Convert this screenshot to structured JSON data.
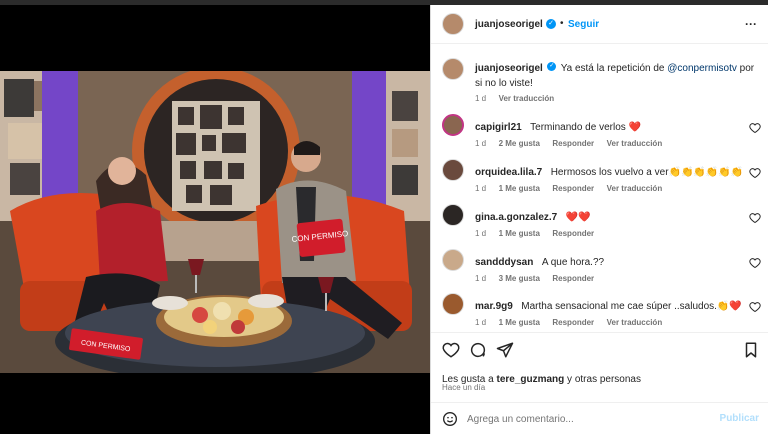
{
  "header": {
    "username": "juanjoseorigel",
    "follow_label": "Seguir",
    "more_label": "···"
  },
  "caption": {
    "username": "juanjoseorigel",
    "text_prefix": "Ya está la repetición de ",
    "mention": "@conpermisotv",
    "text_suffix": " por si no lo viste!",
    "time": "1 d",
    "view_translation": "Ver traducción"
  },
  "comments": [
    {
      "username": "capigirl21",
      "text": "Terminando de verlos ❤️",
      "time": "1 d",
      "likes": "2 Me gusta",
      "reply": "Responder",
      "translate": "Ver traducción"
    },
    {
      "username": "orquidea.lila.7",
      "text": "Hermosos los vuelvo a ver👏👏👏👏👏👏",
      "time": "1 d",
      "likes": "1 Me gusta",
      "reply": "Responder",
      "translate": "Ver traducción"
    },
    {
      "username": "gina.a.gonzalez.7",
      "text": "❤️❤️",
      "time": "1 d",
      "likes": "1 Me gusta",
      "reply": "Responder",
      "translate": ""
    },
    {
      "username": "sandddysan",
      "text": "A que hora.??",
      "time": "1 d",
      "likes": "3 Me gusta",
      "reply": "Responder",
      "translate": ""
    },
    {
      "username": "mar.9g9",
      "text": "Martha sensacional me cae súper ..saludos.👏❤️",
      "time": "1 d",
      "likes": "1 Me gusta",
      "reply": "Responder",
      "translate": "Ver traducción"
    }
  ],
  "likes": {
    "prefix": "Les gusta a ",
    "user": "tere_guzmang",
    "suffix": " y otras personas",
    "time": "Hace un día"
  },
  "composer": {
    "placeholder": "Agrega un comentario...",
    "post_label": "Publicar"
  },
  "photo": {
    "card_text": "CON PERMISO",
    "book_text": "CON PERMISO"
  },
  "colors": {
    "accent": "#0095f6",
    "heart_red": "#ed4956",
    "chair_orange": "#d9471f"
  }
}
